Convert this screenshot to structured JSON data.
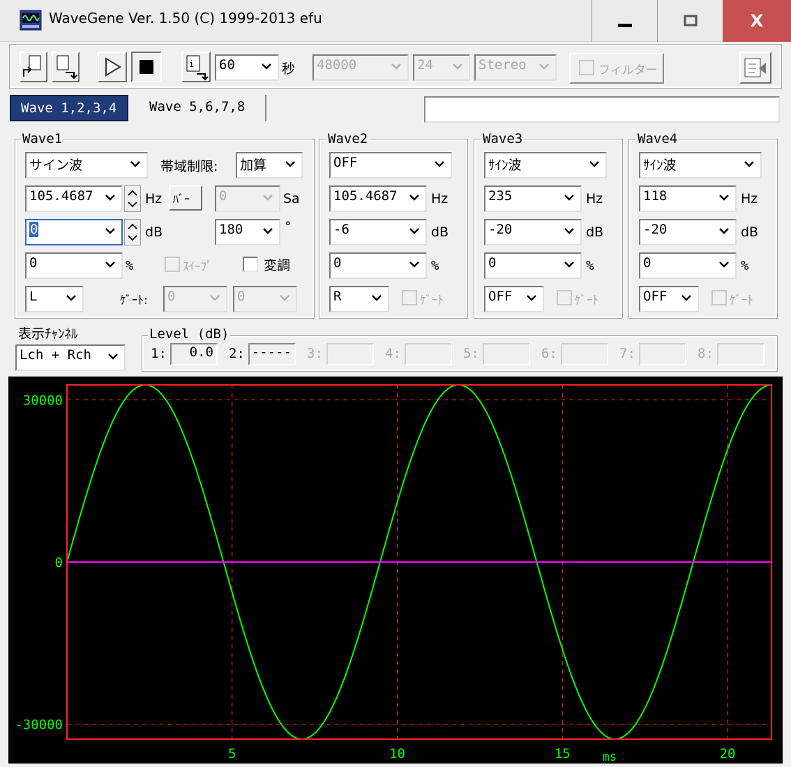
{
  "window": {
    "title": "WaveGene  Ver. 1.50  (C) 1999-2013 efu",
    "minimize": "‒",
    "close": "X"
  },
  "toolbar": {
    "duration": "60",
    "duration_unit": "秒",
    "sample_rate": "48000",
    "bit_depth": "24",
    "channels": "Stereo",
    "filter_label": "フィルター"
  },
  "tabs": [
    {
      "label": "Wave 1,2,3,4",
      "active": true
    },
    {
      "label": "Wave 5,6,7,8",
      "active": false
    }
  ],
  "status_field": "",
  "wave1": {
    "title": "Wave1",
    "type": "サイン波",
    "band_label": "帯域制限:",
    "band_mode": "加算",
    "freq": "105.4687",
    "freq_unit": "Hz",
    "burst_button": "ﾊﾞｰ",
    "samples": "0",
    "samples_unit": "Sa",
    "level": "0",
    "level_unit": "dB",
    "phase": "180",
    "phase_unit": "°",
    "offset": "0",
    "offset_unit": "%",
    "sweep_label": "ｽｲｰﾌﾟ",
    "modulation_label": "変調",
    "channel": "L",
    "gate_label": "ｹﾞｰﾄ:",
    "gate_on": "0",
    "gate_off": "0"
  },
  "wave2": {
    "title": "Wave2",
    "type": "OFF",
    "freq": "105.4687",
    "freq_unit": "Hz",
    "level": "-6",
    "level_unit": "dB",
    "offset": "0",
    "offset_unit": "%",
    "channel": "R",
    "gate_label": "ｹﾞｰﾄ"
  },
  "wave3": {
    "title": "Wave3",
    "type": "ｻｲﾝ波",
    "freq": "235",
    "freq_unit": "Hz",
    "level": "-20",
    "level_unit": "dB",
    "offset": "0",
    "offset_unit": "%",
    "channel": "OFF",
    "gate_label": "ｹﾞｰﾄ"
  },
  "wave4": {
    "title": "Wave4",
    "type": "ｻｲﾝ波",
    "freq": "118",
    "freq_unit": "Hz",
    "level": "-20",
    "level_unit": "dB",
    "offset": "0",
    "offset_unit": "%",
    "channel": "OFF",
    "gate_label": "ｹﾞｰﾄ"
  },
  "display": {
    "title": "表示ﾁｬﾝﾈﾙ",
    "channel": "Lch + Rch"
  },
  "level_meter": {
    "title": "Level (dB)",
    "channels": [
      {
        "label": "1:",
        "value": "0.0",
        "enabled": true
      },
      {
        "label": "2:",
        "value": "-----",
        "enabled": true
      },
      {
        "label": "3:",
        "value": "",
        "enabled": false
      },
      {
        "label": "4:",
        "value": "",
        "enabled": false
      },
      {
        "label": "5:",
        "value": "",
        "enabled": false
      },
      {
        "label": "6:",
        "value": "",
        "enabled": false
      },
      {
        "label": "7:",
        "value": "",
        "enabled": false
      },
      {
        "label": "8:",
        "value": "",
        "enabled": false
      }
    ]
  },
  "colors": {
    "scope_bg": "#000000",
    "frame": "#ff2020",
    "grid": "#ff3030",
    "lch": "#00ff00",
    "rch": "#ff00ff",
    "axis_text": "#00ff00",
    "active_tab": "#1f3c78",
    "close_button": "#c75050"
  },
  "chart_data": {
    "type": "line",
    "xlabel": "ms",
    "xlim": [
      0,
      21.33
    ],
    "ylim": [
      -32768,
      32767
    ],
    "x_ticks": [
      5,
      10,
      15,
      20
    ],
    "y_ticks": [
      30000,
      0,
      -30000
    ],
    "grid": true,
    "series": [
      {
        "frequency_hz": 105.4687,
        "amplitude": 32767,
        "phase_deg": 0
      },
      {
        "frequency_hz": 105.4687,
        "amplitude": 0,
        "phase_deg": 0
      }
    ]
  }
}
